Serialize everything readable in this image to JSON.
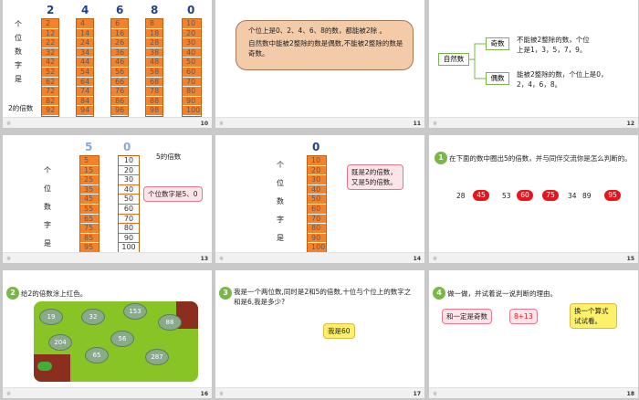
{
  "s10": {
    "number": "10",
    "vlabel": [
      "个",
      "位",
      "数",
      "字",
      "是"
    ],
    "bottom_label": "2的倍数",
    "headers": [
      "2",
      "4",
      "6",
      "8",
      "0"
    ],
    "columns": [
      [
        "2",
        "12",
        "22",
        "32",
        "42",
        "52",
        "62",
        "72",
        "82",
        "92"
      ],
      [
        "4",
        "14",
        "24",
        "34",
        "44",
        "54",
        "64",
        "74",
        "84",
        "94"
      ],
      [
        "6",
        "16",
        "26",
        "36",
        "46",
        "56",
        "66",
        "76",
        "86",
        "96"
      ],
      [
        "8",
        "18",
        "28",
        "38",
        "48",
        "58",
        "68",
        "78",
        "88",
        "98"
      ],
      [
        "10",
        "20",
        "30",
        "40",
        "50",
        "60",
        "70",
        "80",
        "90",
        "100"
      ]
    ]
  },
  "s11": {
    "number": "11",
    "line1": "个位上是0、2、4、6、8的数，都能被2除 。",
    "line2": "自然数中能被2整除的数是偶数,不能被2整除的数是奇数。"
  },
  "s12": {
    "number": "12",
    "root": "自然数",
    "odd": "奇数",
    "odd_desc": "不能被2整除的数，个位上是1，3，5，7，9。",
    "even": "偶数",
    "even_desc": "能被2整除的数，个位上是0，2，4，6，8。"
  },
  "s13": {
    "number": "13",
    "vlabel": [
      "个",
      "位",
      "数",
      "字",
      "是"
    ],
    "title": "5的倍数",
    "callout": "个位数字是5、0",
    "headers": [
      "5",
      "0"
    ],
    "col_a": [
      "5",
      "15",
      "25",
      "35",
      "45",
      "55",
      "65",
      "75",
      "85",
      "95"
    ],
    "col_b": [
      "10",
      "20",
      "30",
      "40",
      "50",
      "60",
      "70",
      "80",
      "90",
      "100"
    ]
  },
  "s14": {
    "number": "14",
    "vlabel": [
      "个",
      "位",
      "数",
      "字",
      "是"
    ],
    "header": "0",
    "col": [
      "10",
      "20",
      "30",
      "40",
      "50",
      "60",
      "70",
      "80",
      "90",
      "100"
    ],
    "callout": "既是2的倍数，又是5的倍数。"
  },
  "s15": {
    "number": "15",
    "badge": "1",
    "text": "在下面的数中圈出5的倍数，并与同伴交流你是怎么判断的。",
    "numbers": [
      "28",
      "45",
      "53",
      "60",
      "75",
      "34",
      "89",
      "95"
    ],
    "circled": [
      false,
      true,
      false,
      true,
      true,
      false,
      false,
      true
    ]
  },
  "s16": {
    "number": "16",
    "badge": "2",
    "text": "给2的倍数涂上红色。",
    "pads": [
      "19",
      "32",
      "153",
      "88",
      "204",
      "56",
      "65",
      "287"
    ]
  },
  "s17": {
    "number": "17",
    "badge": "3",
    "text": "我是一个两位数,同时是2和5的倍数,十位与个位上的数字之和是6,我是多少?",
    "answer": "我是60"
  },
  "s18": {
    "number": "18",
    "badge": "4",
    "text": "做一做，并试着说一说判断的理由。",
    "box1": "和一定是奇数",
    "box2": "8+13",
    "bubble": "换一个算式试试看。"
  }
}
